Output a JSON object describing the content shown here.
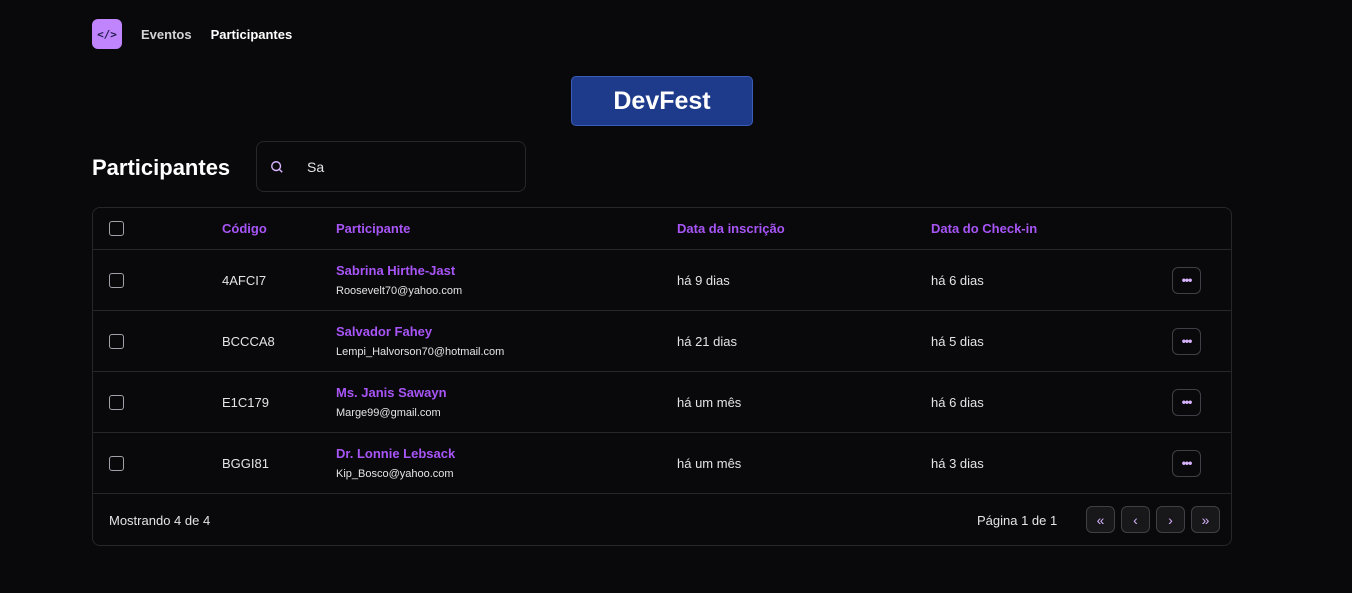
{
  "nav": {
    "logo": "</>",
    "links": [
      "Eventos",
      "Participantes"
    ]
  },
  "event": {
    "name": "DevFest"
  },
  "page": {
    "title": "Participantes"
  },
  "search": {
    "value": "Sa"
  },
  "table": {
    "headers": {
      "code": "Código",
      "participant": "Participante",
      "registered": "Data da inscrição",
      "checkin": "Data do Check-in"
    },
    "rows": [
      {
        "code": "4AFCI7",
        "name": "Sabrina Hirthe-Jast",
        "email": "Roosevelt70@yahoo.com",
        "registered": "há 9 dias",
        "checkin": "há 6 dias"
      },
      {
        "code": "BCCCA8",
        "name": "Salvador Fahey",
        "email": "Lempi_Halvorson70@hotmail.com",
        "registered": "há 21 dias",
        "checkin": "há 5 dias"
      },
      {
        "code": "E1C179",
        "name": "Ms. Janis Sawayn",
        "email": "Marge99@gmail.com",
        "registered": "há um mês",
        "checkin": "há 6 dias"
      },
      {
        "code": "BGGI81",
        "name": "Dr. Lonnie Lebsack",
        "email": "Kip_Bosco@yahoo.com",
        "registered": "há um mês",
        "checkin": "há 3 dias"
      }
    ],
    "more_icon": "•••"
  },
  "footer": {
    "showing": "Mostrando 4 de 4",
    "page_info": "Página 1 de 1",
    "pager": [
      "«",
      "‹",
      "›",
      "»"
    ]
  },
  "colors": {
    "background": "#09090b",
    "accent": "#a855f7",
    "logo": "#c084fc",
    "event_badge": "#1e3a8a"
  }
}
